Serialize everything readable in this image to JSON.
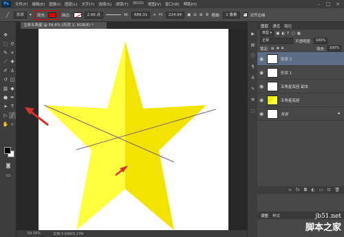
{
  "menubar": {
    "logo": "Ps",
    "items": [
      "文件(F)",
      "编辑(E)",
      "图像(I)",
      "图层(L)",
      "文字(Y)",
      "选择(S)",
      "滤镜(T)",
      "3D(D)",
      "视图(V)",
      "窗口(W)",
      "帮助(H)"
    ]
  },
  "options": {
    "mode": "形状",
    "fill_label": "填充:",
    "fill_color": "#e00000",
    "stroke_label": "描边:",
    "stroke_width": "2.66 点",
    "w_label": "W:",
    "w_value": "689.31",
    "link_icon": "∞",
    "h_label": "H:",
    "h_value": "224.94",
    "weight_label": "粗细:",
    "weight_value": "1 像素",
    "align_label": "对齐边缘"
  },
  "document": {
    "tab_title": "立体五角星 @ 59.6% (形状 2, RGB/8) *",
    "zoom": "59.59%",
    "doc_info": "文档:3.00M/9.27M"
  },
  "layers": {
    "tabs": [
      "图层",
      "通道",
      "路径"
    ],
    "kind_label": "类型",
    "blend_mode": "正常",
    "opacity_label": "不透明度:",
    "opacity_value": "100%",
    "lock_label": "锁定:",
    "fill_label": "填充:",
    "fill_value": "100%",
    "items": [
      {
        "name": "形状 2",
        "selected": true
      },
      {
        "name": "形状 1",
        "selected": false
      },
      {
        "name": "五角星底座 副本",
        "selected": false
      },
      {
        "name": "五角星底座",
        "selected": false
      },
      {
        "name": "背景",
        "selected": false
      }
    ]
  },
  "adjust_tabs": [
    "调整",
    "样式"
  ],
  "watermark": {
    "domain": "jb51.net",
    "text": "脚本之家"
  },
  "colors": {
    "star_light": "#ffff40",
    "star_dark": "#f2e400",
    "annotation_red": "#d63030",
    "line_color": "#7a5f78",
    "selected_layer": "#5d6d86"
  }
}
